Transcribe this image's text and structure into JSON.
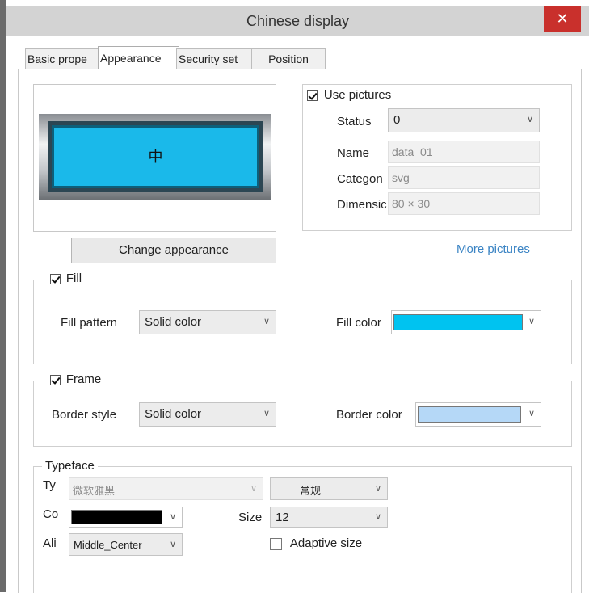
{
  "window": {
    "title": "Chinese display",
    "close_glyph": "✕"
  },
  "tabs": [
    {
      "label": "Basic prope",
      "active": false
    },
    {
      "label": "Appearance",
      "active": true
    },
    {
      "label": "Security set",
      "active": false
    },
    {
      "label": "Position",
      "active": false
    }
  ],
  "preview": {
    "text": "中",
    "fill_color": "#1ab9ea"
  },
  "change_appearance_label": "Change appearance",
  "use_pictures": {
    "label": "Use pictures",
    "checked": true,
    "status_label": "Status",
    "status_value": "0",
    "name_label": "Name",
    "name_value": "data_01",
    "category_label": "Categon",
    "category_value": "svg",
    "dimension_label": "Dimensic",
    "dimension_value": "80 × 30",
    "more_pictures_label": "More pictures"
  },
  "fill": {
    "label": "Fill",
    "checked": true,
    "pattern_label": "Fill pattern",
    "pattern_value": "Solid color",
    "color_label": "Fill color",
    "color": "#00c3f0"
  },
  "frame": {
    "label": "Frame",
    "checked": true,
    "style_label": "Border style",
    "style_value": "Solid color",
    "color_label": "Border color",
    "color": "#b5d8f7"
  },
  "typeface": {
    "legend": "Typeface",
    "type_label": "Ty",
    "type_value": "微软雅黑",
    "weight_value": "常规",
    "color_label": "Co",
    "color": "#000000",
    "size_label": "Size",
    "size_value": "12",
    "align_label": "Ali",
    "align_value": "Middle_Center",
    "adaptive_label": "Adaptive size",
    "adaptive_checked": false
  },
  "arrow_glyph": "∨"
}
